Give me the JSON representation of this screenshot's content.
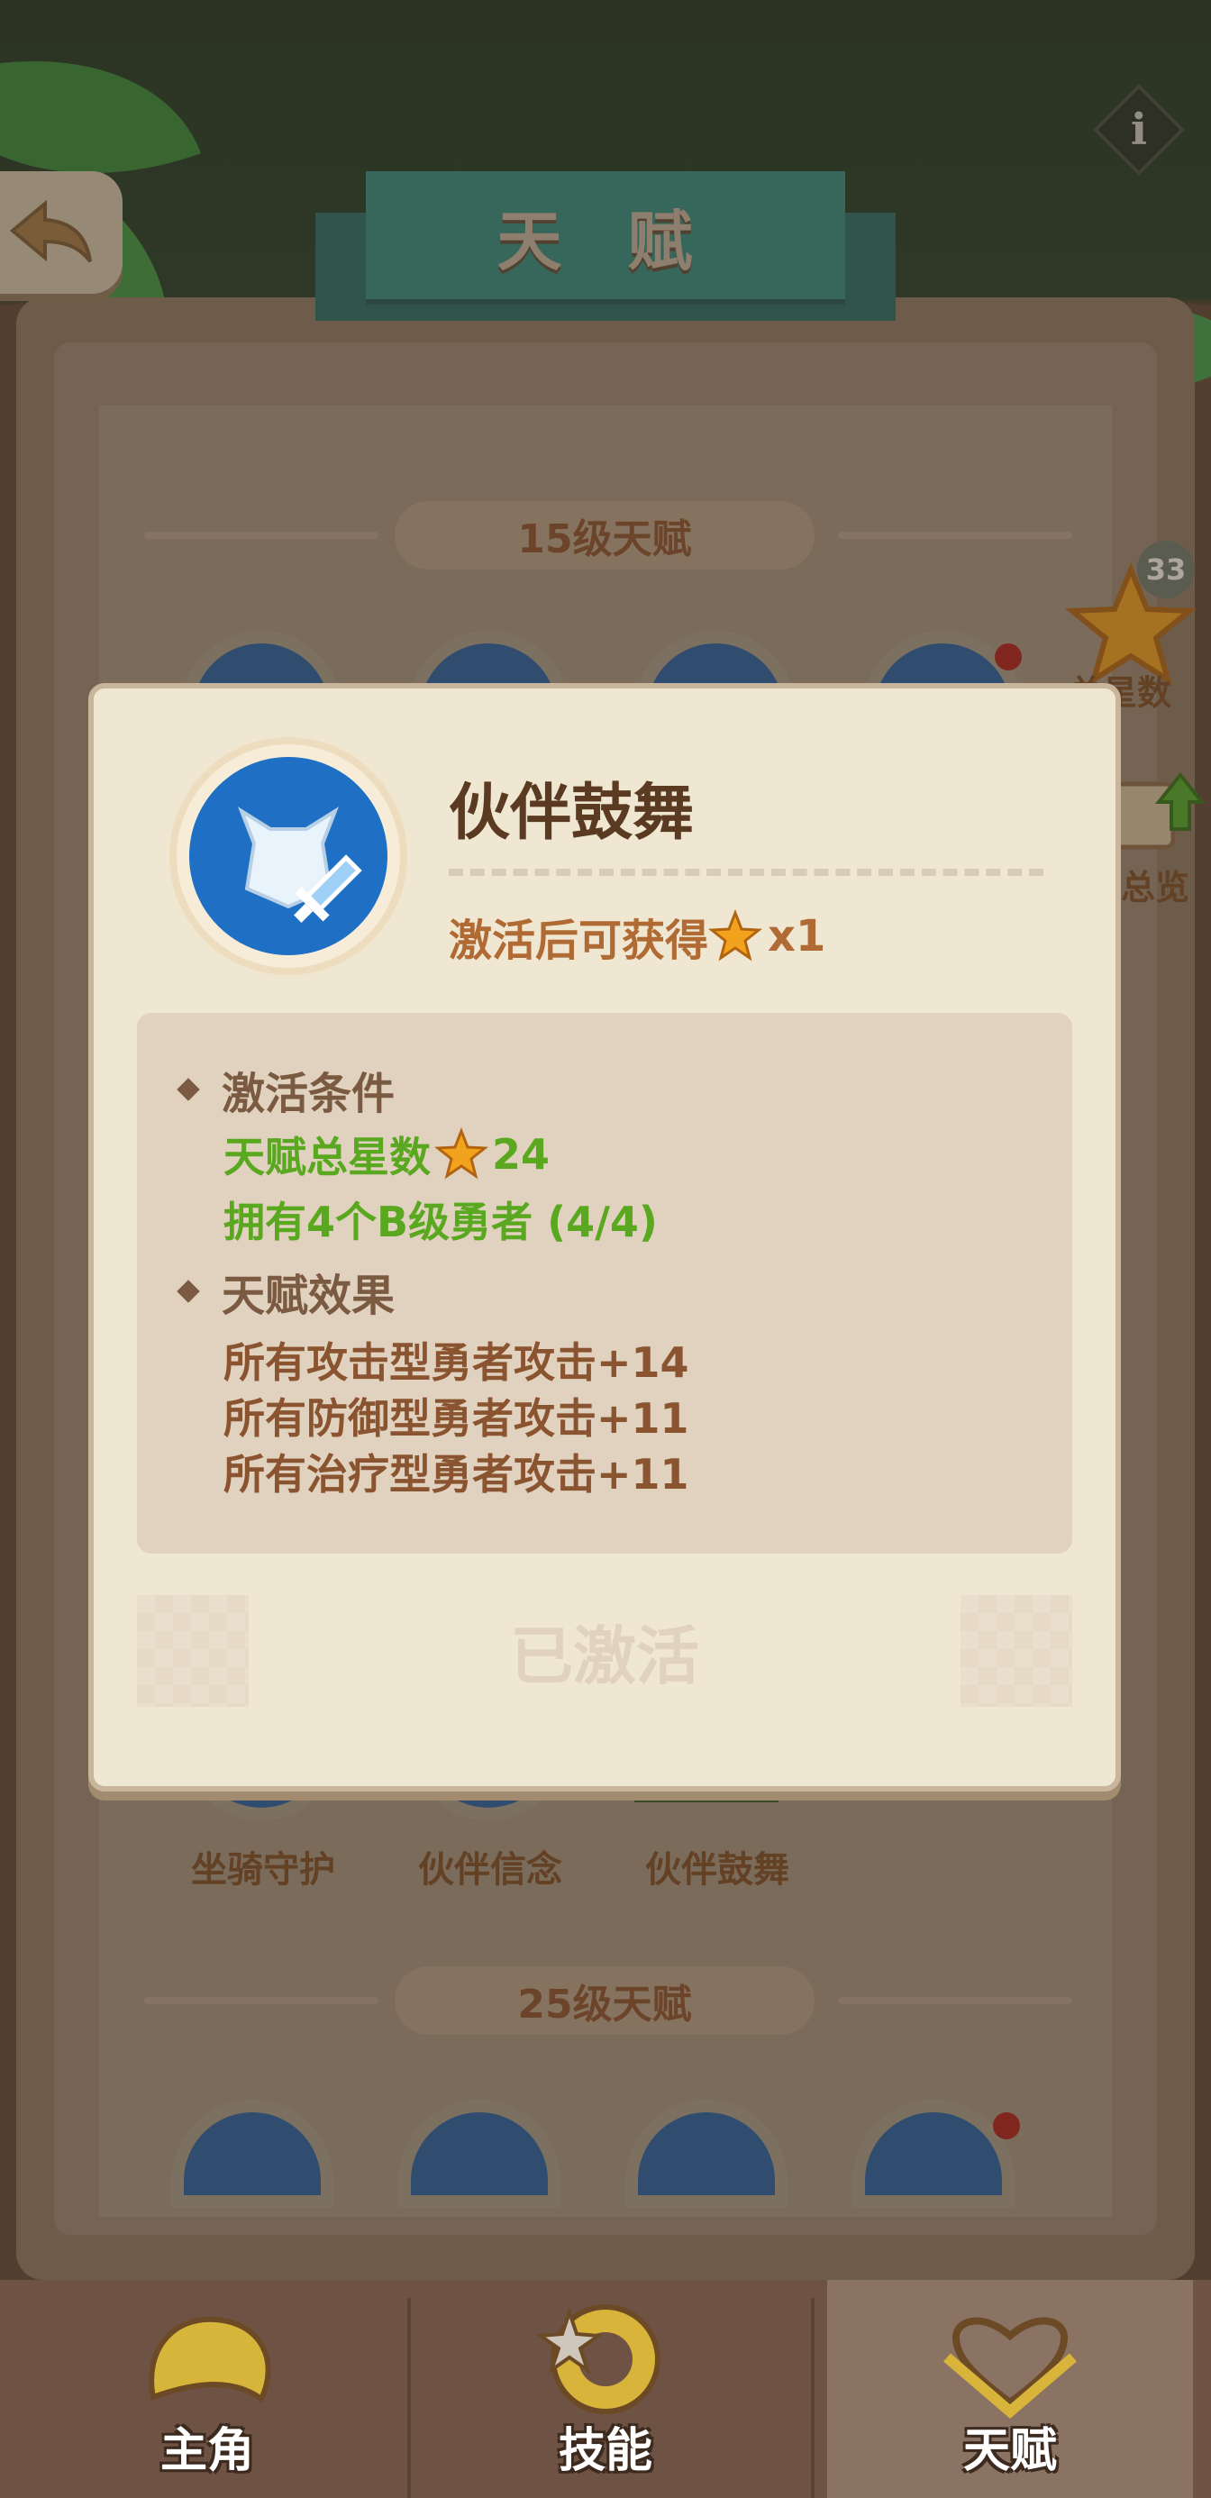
{
  "header": {
    "title": "天 赋"
  },
  "side": {
    "total_stars_count": "33",
    "total_stars_label": "总星数",
    "overview_label": "总览"
  },
  "board": {
    "tier15_label": "15级天赋",
    "tier25_label": "25级天赋",
    "tier15_talents": [
      {
        "label": "坐骑守护"
      },
      {
        "label": "伙伴信念"
      },
      {
        "label": "伙伴鼓舞"
      }
    ]
  },
  "dialog": {
    "talent_name": "伙伴鼓舞",
    "reward_text": "激活后可获得",
    "reward_multiplier": "x1",
    "conditions_heading": "激活条件",
    "condition_stars_label": "天赋总星数",
    "condition_stars_value": "24",
    "condition_heroes": "拥有4个B级勇者 (4/4)",
    "effects_heading": "天赋效果",
    "effects": [
      "所有攻击型勇者攻击+14",
      "所有防御型勇者攻击+11",
      "所有治疗型勇者攻击+11"
    ],
    "activated_label": "已激活"
  },
  "nav": {
    "items": [
      {
        "label": "主角"
      },
      {
        "label": "技能"
      },
      {
        "label": "天赋"
      }
    ]
  },
  "colors": {
    "condition_met": "#5aa81f",
    "effect_text": "#8a5430",
    "banner": "#2b8c85",
    "talent_blue": "#1f6fc5"
  }
}
